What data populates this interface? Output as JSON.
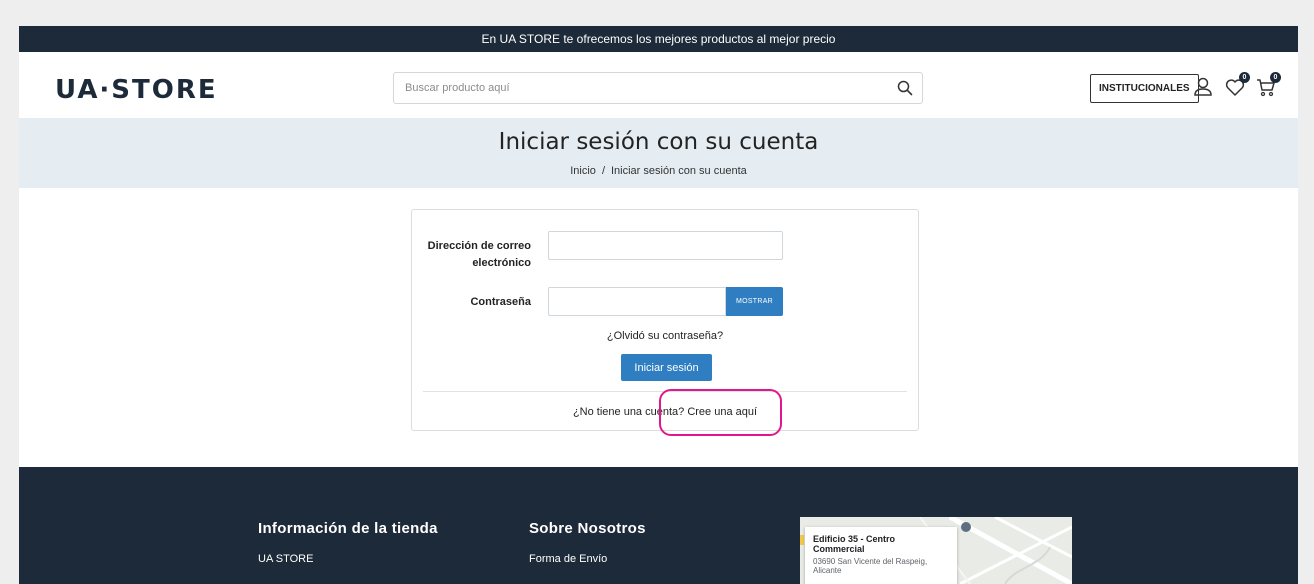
{
  "topbar": {
    "message": "En UA STORE te ofrecemos los mejores productos al mejor precio"
  },
  "header": {
    "logo": "UA·STORE",
    "search_placeholder": "Buscar producto aquí",
    "institutional_label": "INSTITUCIONALES",
    "wishlist_count": "0",
    "cart_count": "0"
  },
  "page": {
    "title": "Iniciar sesión con su cuenta",
    "breadcrumb": {
      "home": "Inicio",
      "separator": "/",
      "current": "Iniciar sesión con su cuenta"
    }
  },
  "login": {
    "email_label_line1": "Dirección de correo",
    "email_label_line2": "electrónico",
    "email_value": "",
    "password_label": "Contraseña",
    "password_value": "",
    "show_label": "MOSTRAR",
    "forgot_link": "¿Olvidó su contraseña?",
    "submit_label": "Iniciar sesión",
    "no_account_text": "¿No tiene una cuenta?",
    "create_link": "Cree una aquí"
  },
  "footer": {
    "store_info_title": "Información de la tienda",
    "store_name": "UA STORE",
    "about_title": "Sobre Nosotros",
    "shipping_link": "Forma de Envío",
    "map": {
      "place_name": "Edificio 35 - Centro Commercial",
      "address_line1": "03690 San Vicente del Raspeig,",
      "address_line2": "Alicante"
    }
  },
  "colors": {
    "navy": "#1c2a39",
    "accent_blue": "#2f7ec1",
    "banner": "#e6edf2",
    "highlight": "#e0188d"
  }
}
